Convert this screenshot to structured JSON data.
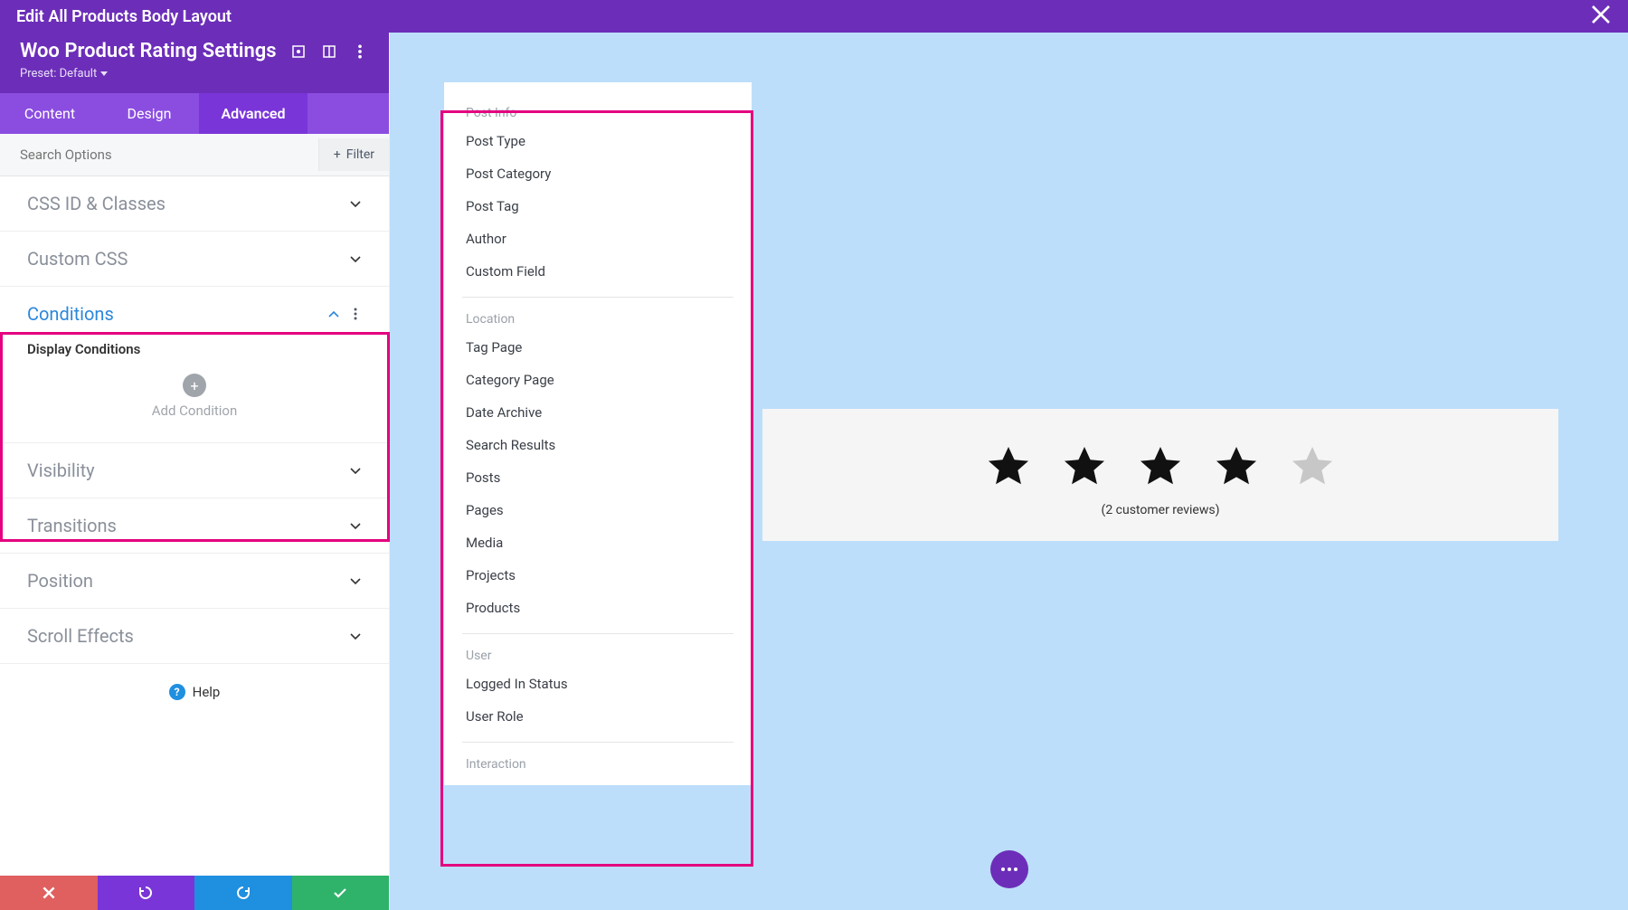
{
  "topBar": {
    "title": "Edit All Products Body Layout"
  },
  "sidebar": {
    "title": "Woo Product Rating Settings",
    "presetLabel": "Preset: Default"
  },
  "tabs": {
    "items": [
      "Content",
      "Design",
      "Advanced"
    ],
    "active": 2
  },
  "search": {
    "placeholder": "Search Options",
    "filterLabel": "Filter"
  },
  "sections": {
    "cssId": "CSS ID & Classes",
    "customCss": "Custom CSS",
    "conditions": "Conditions",
    "displayConditions": "Display Conditions",
    "addCondition": "Add Condition",
    "visibility": "Visibility",
    "transitions": "Transitions",
    "position": "Position",
    "scrollEffects": "Scroll Effects"
  },
  "help": "Help",
  "popup": {
    "groups": [
      {
        "title": "Post Info",
        "items": [
          "Post Type",
          "Post Category",
          "Post Tag",
          "Author",
          "Custom Field"
        ]
      },
      {
        "title": "Location",
        "items": [
          "Tag Page",
          "Category Page",
          "Date Archive",
          "Search Results",
          "Posts",
          "Pages",
          "Media",
          "Projects",
          "Products"
        ]
      },
      {
        "title": "User",
        "items": [
          "Logged In Status",
          "User Role"
        ]
      },
      {
        "title": "Interaction",
        "items": []
      }
    ]
  },
  "rating": {
    "stars": 4,
    "reviews": "(2 customer reviews)"
  }
}
